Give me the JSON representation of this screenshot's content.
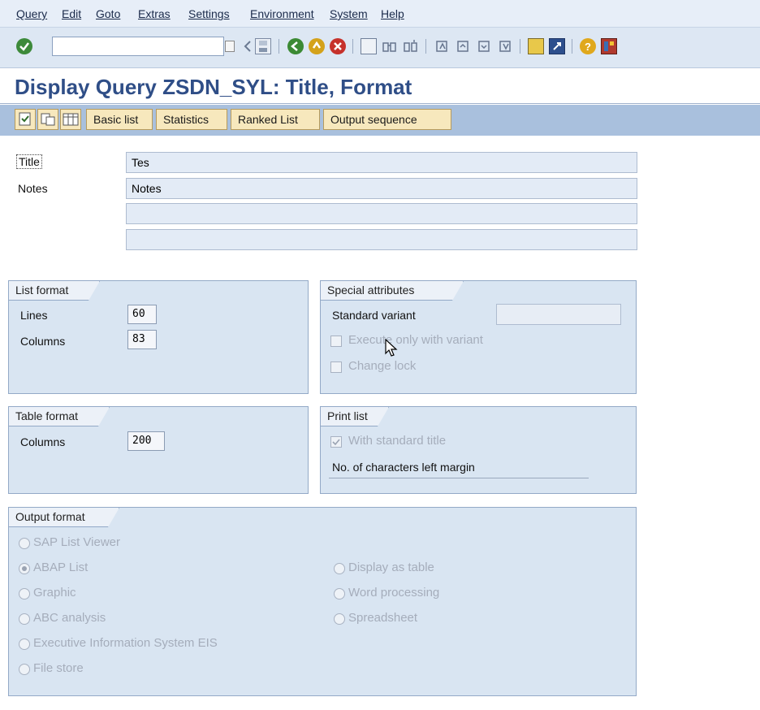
{
  "menu": {
    "items": [
      "Query",
      "Edit",
      "Goto",
      "Extras",
      "Settings",
      "Environment",
      "System",
      "Help"
    ],
    "underlines": [
      "Q",
      "E",
      "G",
      "a",
      "S",
      "v",
      "y",
      "H"
    ]
  },
  "toolbar": {
    "command_field": "",
    "icons": [
      "enter-icon",
      "save-icon",
      "back-icon",
      "exit-icon",
      "cancel-icon",
      "print-icon",
      "find-icon",
      "find-next-icon",
      "first-page-icon",
      "previous-page-icon",
      "next-page-icon",
      "last-page-icon",
      "create-session-icon",
      "shortcut-icon",
      "help-icon",
      "layout-menu-icon"
    ]
  },
  "page_title": "Display Query ZSDN_SYL: Title, Format",
  "app_toolbar": {
    "basic_list": "Basic list",
    "statistics": "Statistics",
    "ranked_list": "Ranked List",
    "output_sequence": "Output sequence"
  },
  "header": {
    "title_label": "Title",
    "title_value": "Tes",
    "notes_label": "Notes",
    "notes_value": "Notes",
    "notes_line2": "",
    "notes_line3": ""
  },
  "list_format": {
    "heading": "List format",
    "lines_label": "Lines",
    "lines_value": "60",
    "columns_label": "Columns",
    "columns_value": "83"
  },
  "special_attributes": {
    "heading": "Special attributes",
    "standard_variant_label": "Standard variant",
    "standard_variant_value": "",
    "execute_only_label": "Execute only with variant",
    "execute_only_checked": false,
    "change_lock_label": "Change lock",
    "change_lock_checked": false
  },
  "table_format": {
    "heading": "Table format",
    "columns_label": "Columns",
    "columns_value": "200"
  },
  "print_list": {
    "heading": "Print list",
    "with_standard_title_label": "With standard title",
    "with_standard_title_checked": true,
    "left_margin_label": "No. of characters left margin",
    "left_margin_value": ""
  },
  "output_format": {
    "heading": "Output format",
    "options": [
      {
        "label": "SAP List Viewer",
        "selected": false
      },
      {
        "label": "ABAP List",
        "selected": true
      },
      {
        "label": "Graphic",
        "selected": false
      },
      {
        "label": "ABC analysis",
        "selected": false
      },
      {
        "label": "Executive Information System EIS",
        "selected": false
      },
      {
        "label": "File store",
        "selected": false
      },
      {
        "label": "Display as table",
        "selected": false
      },
      {
        "label": "Word processing",
        "selected": false
      },
      {
        "label": "Spreadsheet",
        "selected": false
      }
    ]
  },
  "colors": {
    "title": "#2f4e87",
    "app_toolbar": "#a9c0dd",
    "group_bg": "#d9e5f2",
    "button_bg": "#f7e8bd"
  }
}
